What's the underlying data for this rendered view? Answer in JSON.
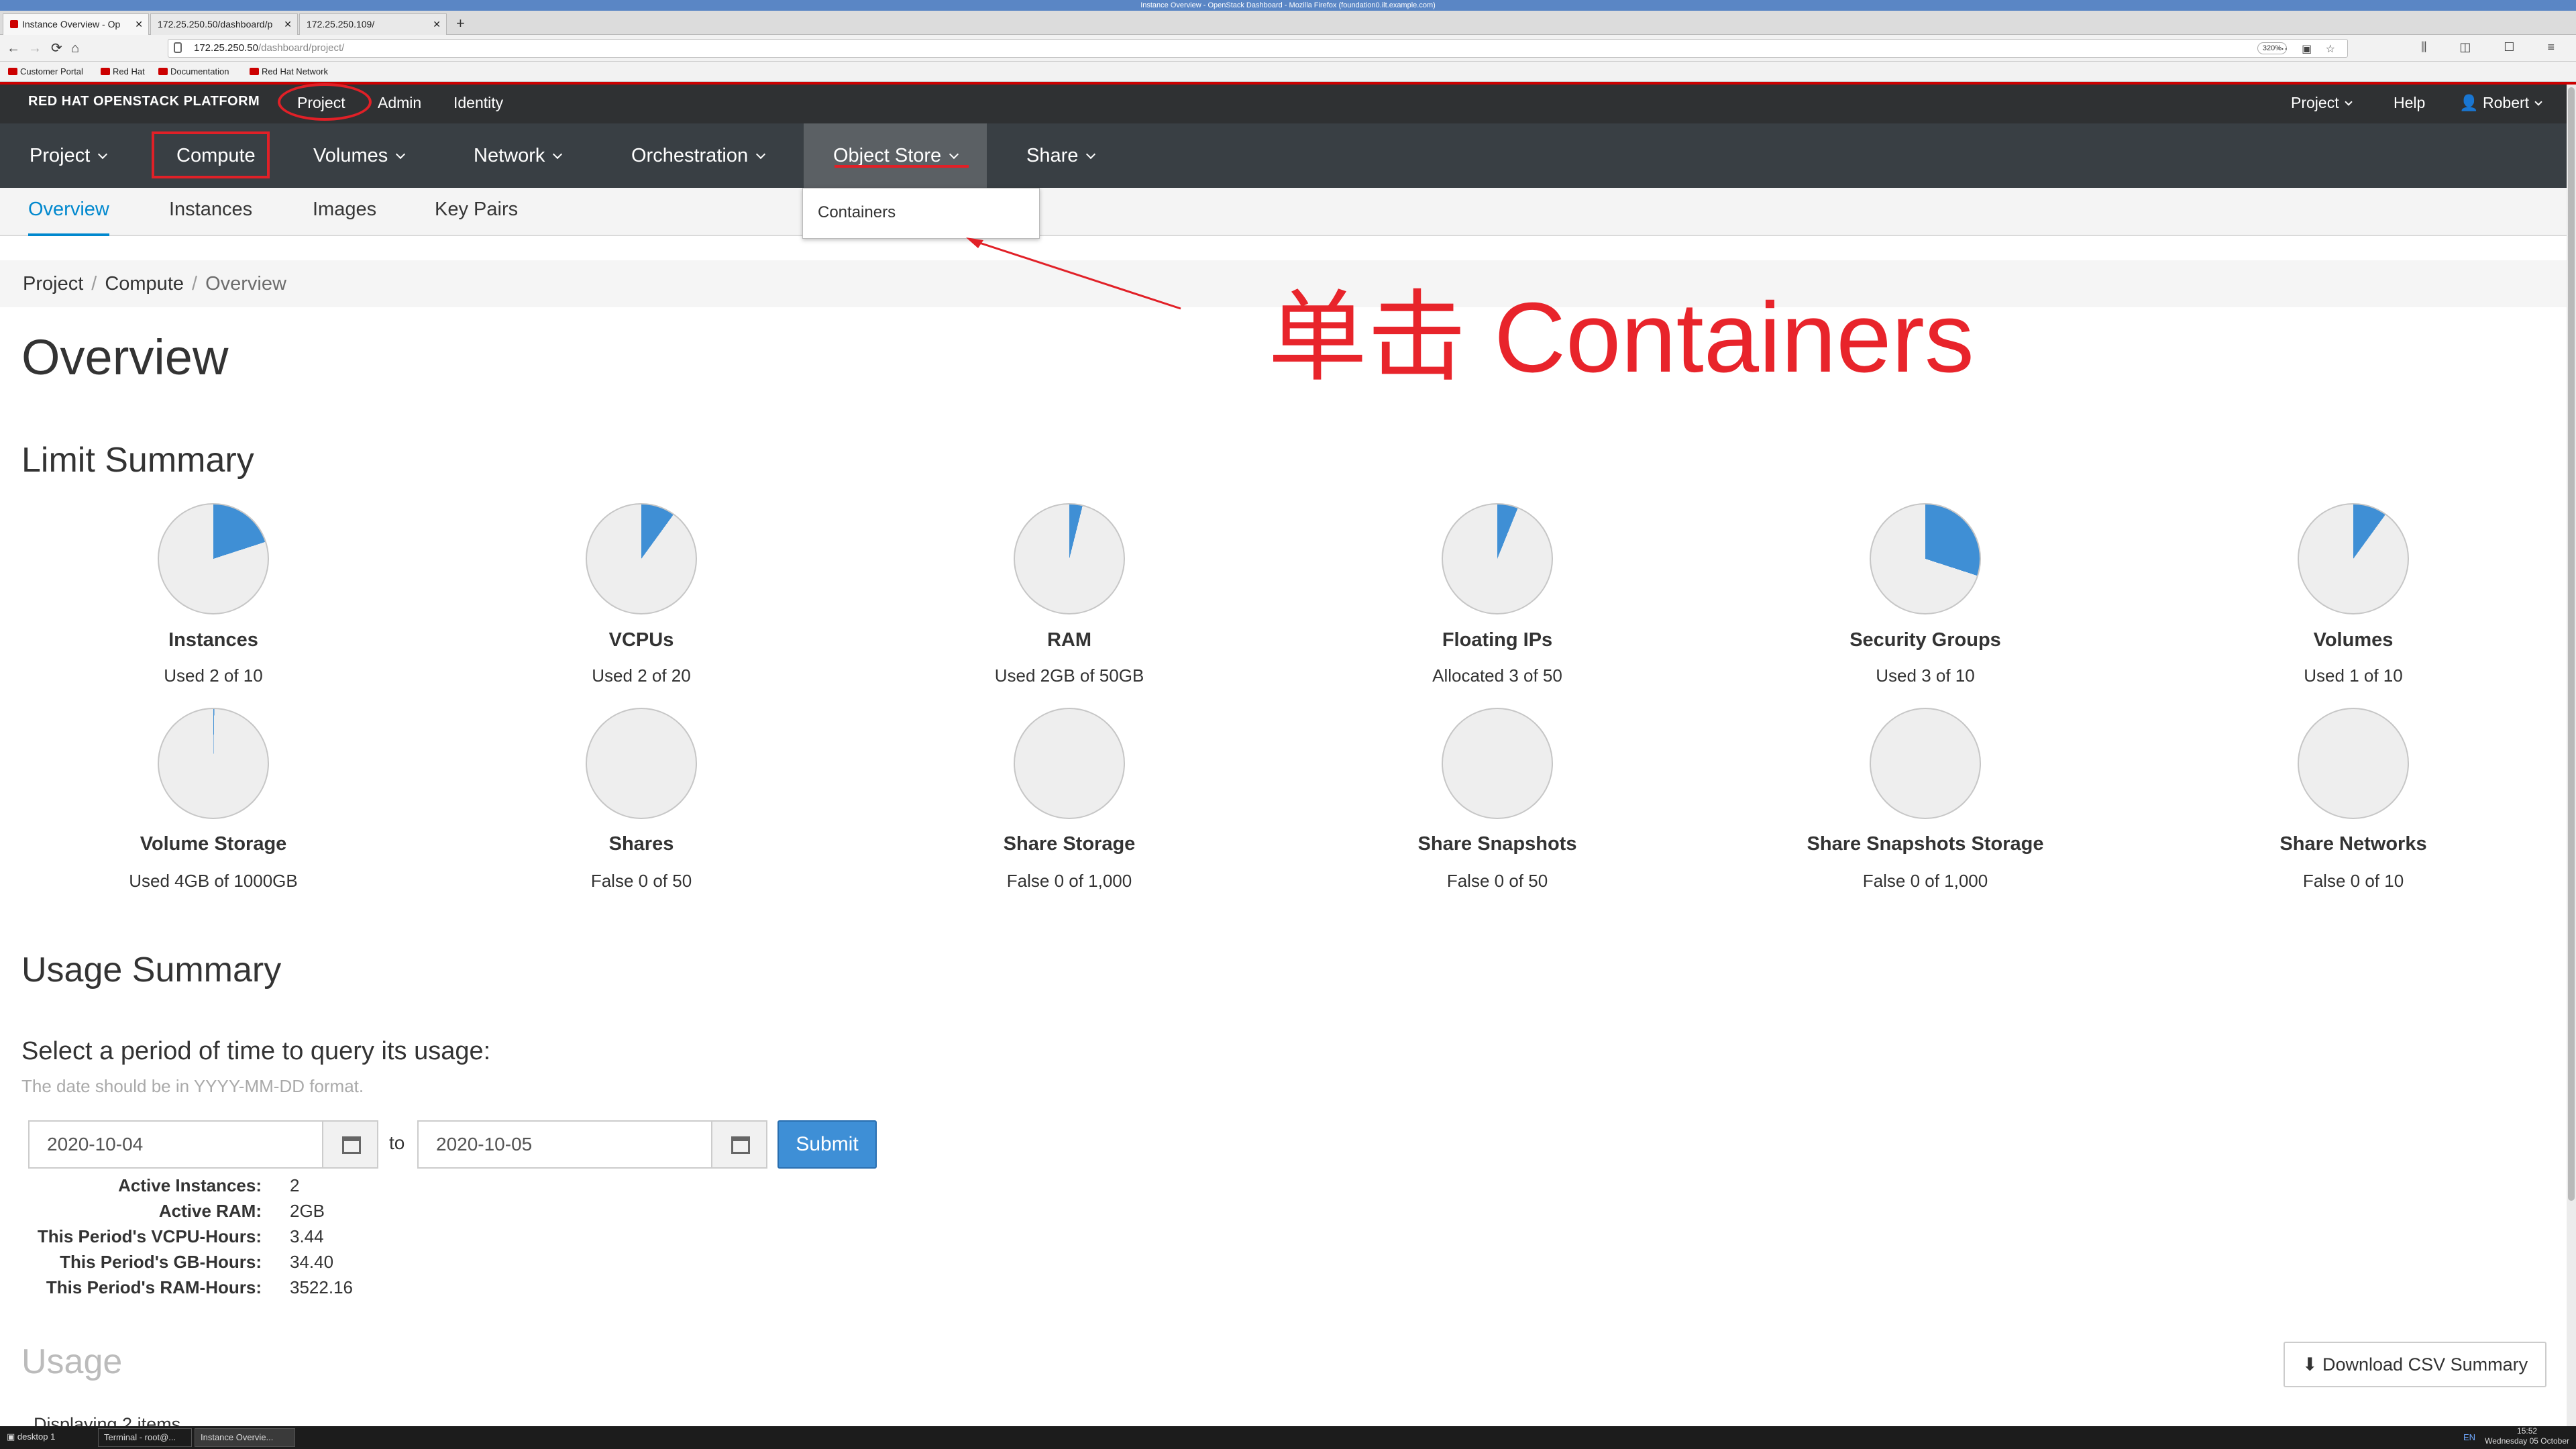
{
  "window_title": "Instance Overview - OpenStack Dashboard - Mozilla Firefox (foundation0.ilt.example.com)",
  "tabs": [
    {
      "label": "Instance Overview - Op",
      "active": true
    },
    {
      "label": "172.25.250.50/dashboard/p",
      "active": false
    },
    {
      "label": "172.25.250.109/",
      "active": false
    }
  ],
  "url": {
    "host": "172.25.250.50",
    "path": "/dashboard/project/"
  },
  "zoom": "320%",
  "bookmarks": [
    "Customer Portal",
    "Red Hat",
    "Documentation",
    "Red Hat Network"
  ],
  "masthead": {
    "brand": "RED HAT OPENSTACK PLATFORM",
    "links": [
      "Project",
      "Admin",
      "Identity"
    ],
    "right": {
      "project": "Project",
      "help": "Help",
      "user": "Robert"
    }
  },
  "nav": [
    "Project",
    "Compute",
    "Volumes",
    "Network",
    "Orchestration",
    "Object Store",
    "Share"
  ],
  "subnav": [
    "Overview",
    "Instances",
    "Images",
    "Key Pairs"
  ],
  "dropdown": {
    "item": "Containers"
  },
  "breadcrumb": [
    "Project",
    "Compute",
    "Overview"
  ],
  "page_title": "Overview",
  "limit_summary": {
    "title": "Limit Summary",
    "items": [
      {
        "name": "Instances",
        "text": "Used 2 of 10",
        "fraction": 0.2
      },
      {
        "name": "VCPUs",
        "text": "Used 2 of 20",
        "fraction": 0.1
      },
      {
        "name": "RAM",
        "text": "Used 2GB of 50GB",
        "fraction": 0.04
      },
      {
        "name": "Floating IPs",
        "text": "Allocated 3 of 50",
        "fraction": 0.06
      },
      {
        "name": "Security Groups",
        "text": "Used 3 of 10",
        "fraction": 0.3
      },
      {
        "name": "Volumes",
        "text": "Used 1 of 10",
        "fraction": 0.1
      },
      {
        "name": "Volume Storage",
        "text": "Used 4GB of 1000GB",
        "fraction": 0.004
      },
      {
        "name": "Shares",
        "text": "False 0 of 50",
        "fraction": 0
      },
      {
        "name": "Share Storage",
        "text": "False 0 of 1,000",
        "fraction": 0
      },
      {
        "name": "Share Snapshots",
        "text": "False 0 of 50",
        "fraction": 0
      },
      {
        "name": "Share Snapshots Storage",
        "text": "False 0 of 1,000",
        "fraction": 0
      },
      {
        "name": "Share Networks",
        "text": "False 0 of 10",
        "fraction": 0
      }
    ]
  },
  "usage_summary": {
    "title": "Usage Summary",
    "query": "Select a period of time to query its usage:",
    "hint": "The date should be in YYYY-MM-DD format.",
    "from": "2020-10-04",
    "to_label": "to",
    "to": "2020-10-05",
    "submit": "Submit",
    "stats": [
      {
        "label": "Active Instances:",
        "value": "2"
      },
      {
        "label": "Active RAM:",
        "value": "2GB"
      },
      {
        "label": "This Period's VCPU-Hours:",
        "value": "3.44"
      },
      {
        "label": "This Period's GB-Hours:",
        "value": "34.40"
      },
      {
        "label": "This Period's RAM-Hours:",
        "value": "3522.16"
      }
    ]
  },
  "usage": {
    "title": "Usage",
    "csv_button": "Download CSV Summary",
    "displaying": "Displaying 2 items"
  },
  "annotation": {
    "text": "单击 Containers"
  },
  "colors": {
    "pie_fill": "#3f8fd5",
    "annotation": "#e8242b",
    "masthead": "#2f3133",
    "nav": "#393f44",
    "accent": "#0088ce"
  },
  "taskbar": {
    "desktop": "desktop 1",
    "tasks": [
      "Terminal - root@...",
      "Instance Overvie..."
    ],
    "lang": "EN",
    "time": "15:52",
    "date": "Wednesday 05 October"
  }
}
